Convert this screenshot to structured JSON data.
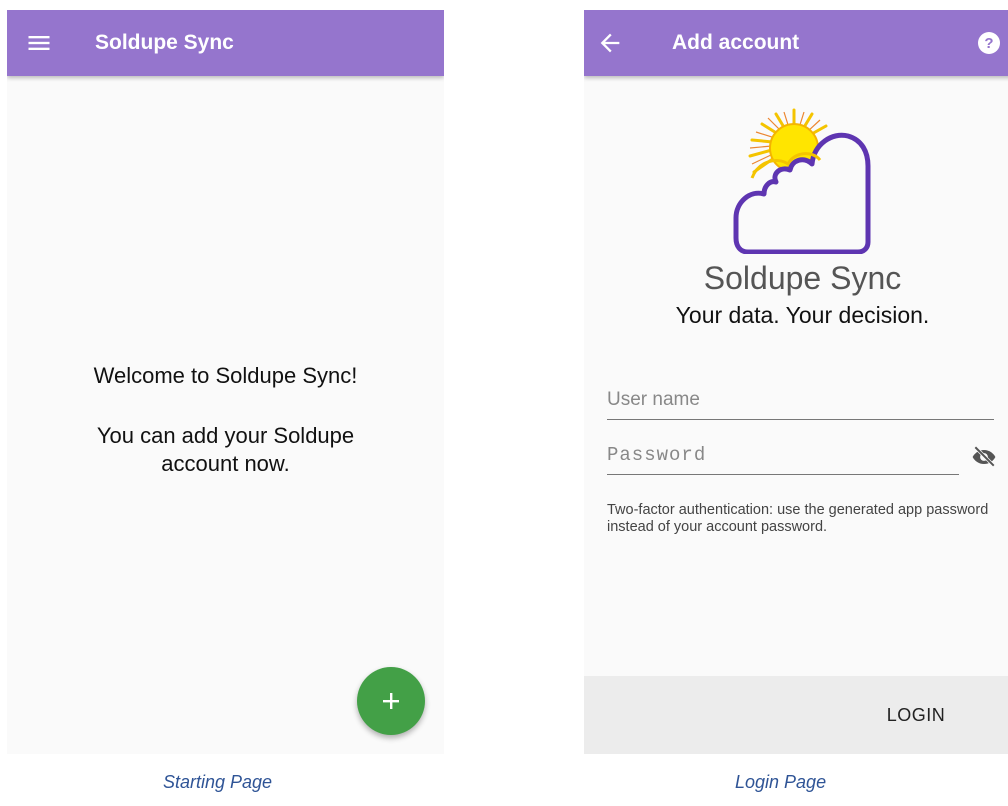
{
  "start_screen": {
    "toolbar": {
      "title": "Soldupe Sync",
      "menu_icon": "hamburger-menu-icon"
    },
    "welcome_line1": "Welcome to Soldupe Sync!",
    "welcome_line2": "You can add your Soldupe",
    "welcome_line3": "account now.",
    "fab": {
      "icon": "plus-icon",
      "label": "+"
    }
  },
  "login_screen": {
    "toolbar": {
      "title": "Add account",
      "back_icon": "arrow-back-icon",
      "help_icon": "help-icon"
    },
    "app_name": "Soldupe Sync",
    "tagline": "Your data. Your decision.",
    "username_placeholder": "User name",
    "password_placeholder": "Password",
    "password_toggle_icon": "eye-off-icon",
    "hint": "Two-factor authentication: use the generated app password instead of your account password.",
    "login_label": "LOGIN"
  },
  "captions": {
    "start": "Starting Page",
    "login": "Login Page"
  },
  "colors": {
    "app_bar": "#9575cd",
    "fab": "#43a047",
    "caption": "#2f5496"
  }
}
